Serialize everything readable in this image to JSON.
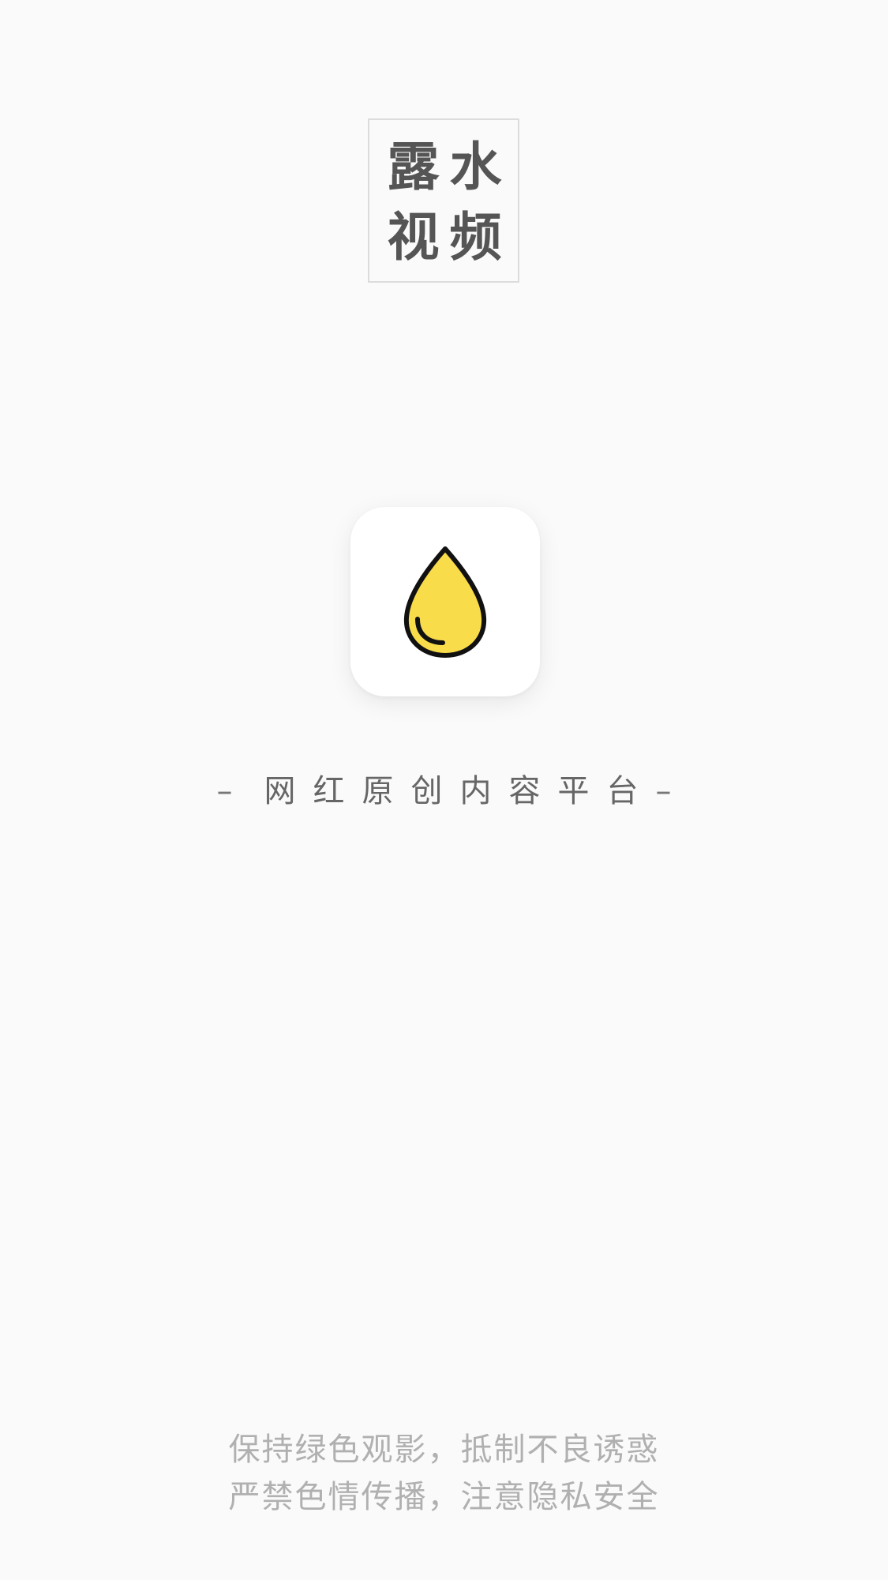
{
  "title": {
    "chars": [
      "露",
      "水",
      "视",
      "频"
    ]
  },
  "app_icon": {
    "icon_name": "water-drop-icon",
    "drop_color": "#f9dc4a",
    "outline_color": "#111111"
  },
  "slogan": {
    "left_dash": "–",
    "text": "网红原创内容平台",
    "right_dash": "–"
  },
  "notice": {
    "line1": "保持绿色观影，抵制不良诱惑",
    "line2": "严禁色情传播，注意隐私安全"
  },
  "colors": {
    "background": "#fafafa",
    "title_text": "#555555",
    "slogan_text": "#666666",
    "notice_text": "#b0b0b0"
  }
}
